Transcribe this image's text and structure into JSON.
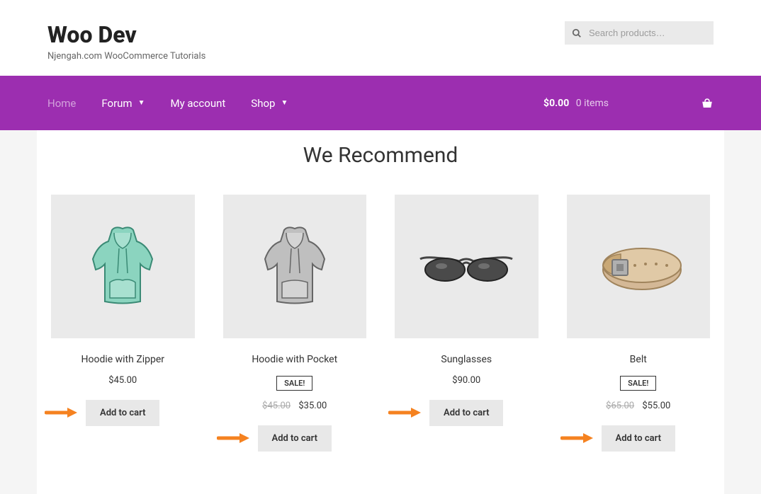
{
  "site": {
    "title": "Woo Dev",
    "tagline": "Njengah.com WooCommerce Tutorials"
  },
  "search": {
    "placeholder": "Search products…"
  },
  "nav": {
    "items": [
      {
        "label": "Home",
        "current": true,
        "hasDropdown": false
      },
      {
        "label": "Forum",
        "current": false,
        "hasDropdown": true
      },
      {
        "label": "My account",
        "current": false,
        "hasDropdown": false
      },
      {
        "label": "Shop",
        "current": false,
        "hasDropdown": true
      }
    ],
    "cart": {
      "price": "$0.00",
      "items": "0 items"
    }
  },
  "section": {
    "title": "We Recommend"
  },
  "products": [
    {
      "title": "Hoodie with Zipper",
      "sale": false,
      "oldPrice": "",
      "price": "$45.00",
      "cta": "Add to cart"
    },
    {
      "title": "Hoodie with Pocket",
      "sale": true,
      "saleLabel": "SALE!",
      "oldPrice": "$45.00",
      "price": "$35.00",
      "cta": "Add to cart"
    },
    {
      "title": "Sunglasses",
      "sale": false,
      "oldPrice": "",
      "price": "$90.00",
      "cta": "Add to cart"
    },
    {
      "title": "Belt",
      "sale": true,
      "saleLabel": "SALE!",
      "oldPrice": "$65.00",
      "price": "$55.00",
      "cta": "Add to cart"
    }
  ]
}
